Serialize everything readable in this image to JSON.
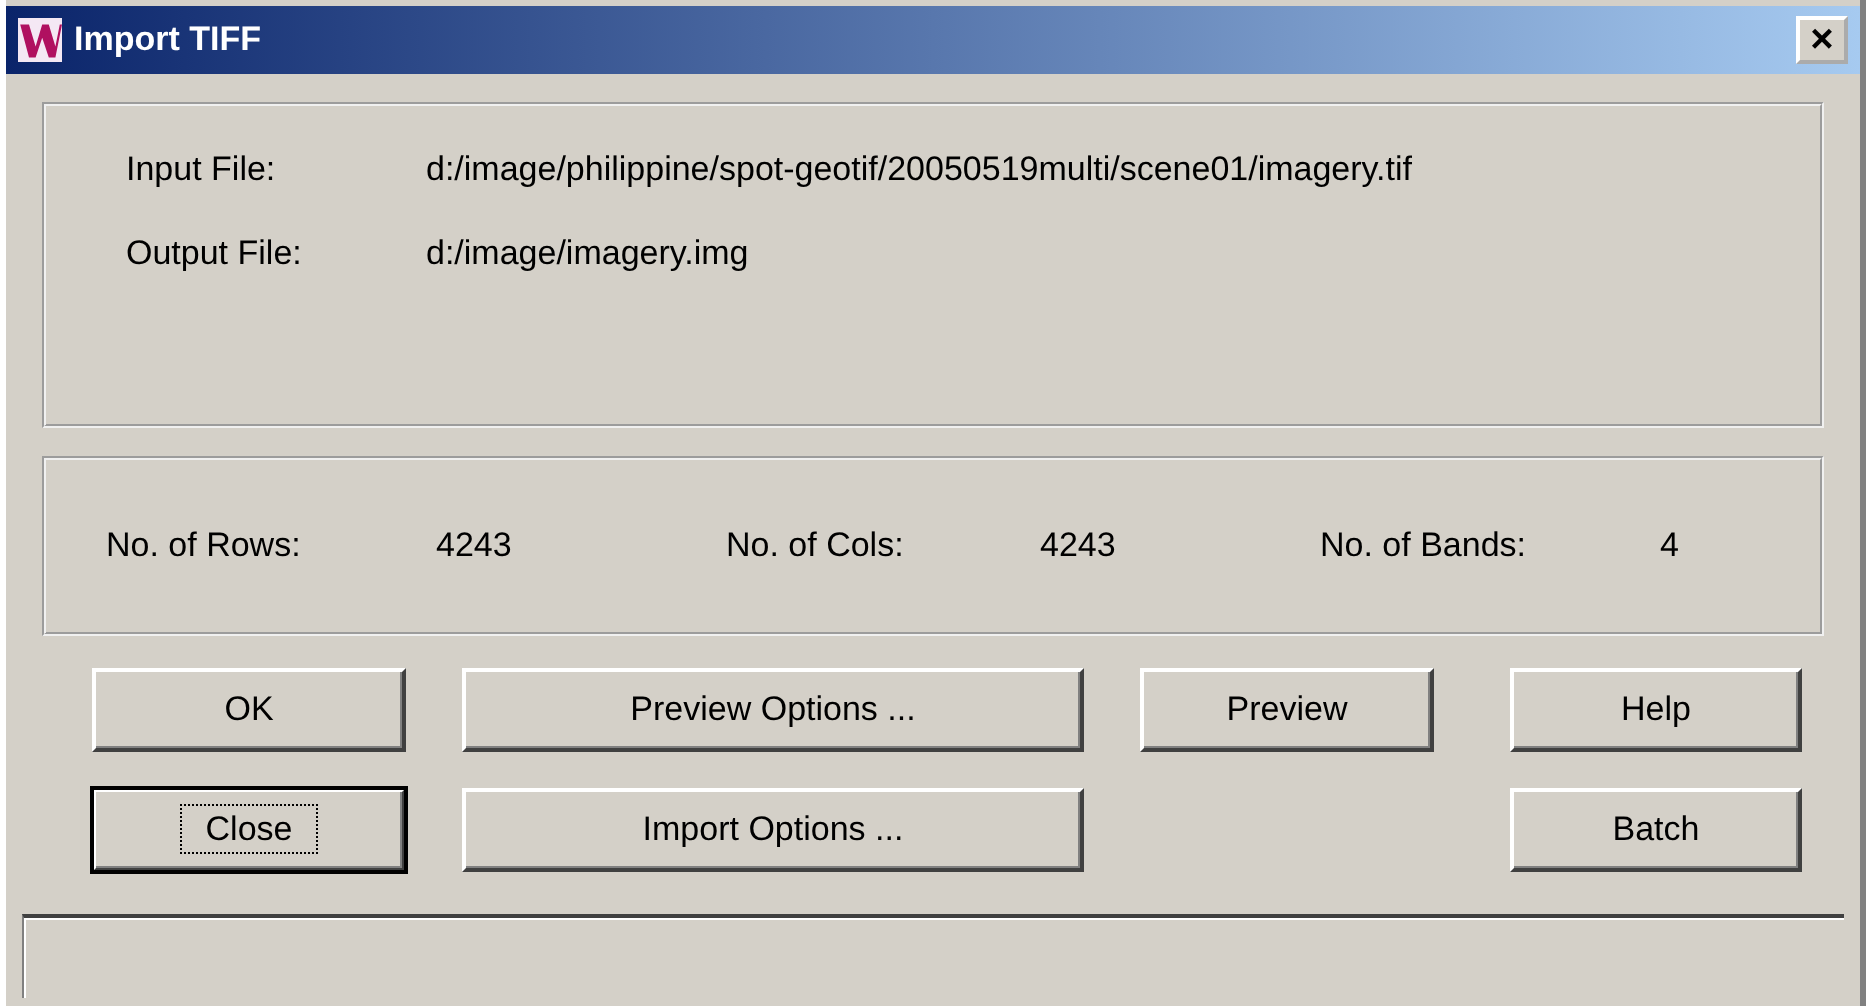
{
  "window": {
    "title": "Import TIFF",
    "close": "×"
  },
  "files": [
    {
      "label": "Input File:",
      "value": "d:/image/philippine/spot-geotif/20050519multi/scene01/imagery.tif"
    },
    {
      "label": "Output File:",
      "value": "d:/image/imagery.img"
    }
  ],
  "info": [
    {
      "label": "No. of Rows:",
      "value": "4243"
    },
    {
      "label": "No. of Cols:",
      "value": "4243"
    },
    {
      "label": "No. of Bands:",
      "value": "4"
    }
  ],
  "button_rows": [
    [
      {
        "label": "OK",
        "focused": false
      },
      {
        "label": "Preview Options ...",
        "focused": false
      },
      {
        "label": "Preview",
        "focused": false
      },
      {
        "label": "Help",
        "focused": false
      }
    ],
    [
      {
        "label": "Close",
        "focused": true
      },
      {
        "label": "Import Options ...",
        "focused": false
      },
      {
        "label": "Batch",
        "focused": false
      }
    ]
  ]
}
